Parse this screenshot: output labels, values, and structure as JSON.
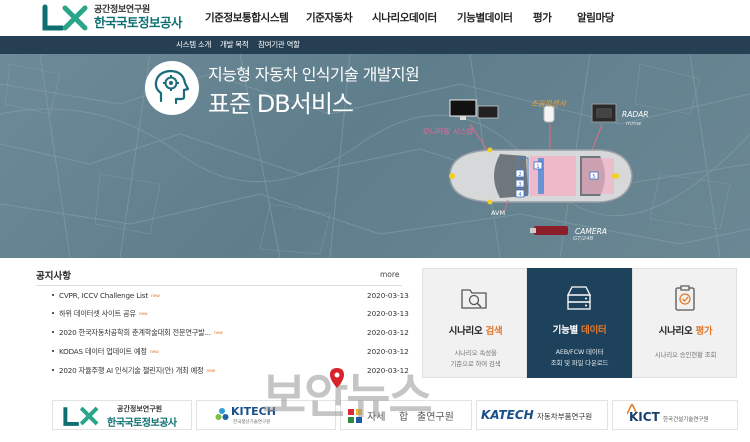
{
  "header": {
    "logo_sub": "공간정보연구원",
    "logo_main": "한국국토정보공사",
    "nav": [
      {
        "label": "기준정보통합시스템"
      },
      {
        "label": "기준자동차"
      },
      {
        "label": "시나리오데이터"
      },
      {
        "label": "기능별데이터"
      },
      {
        "label": "평가"
      },
      {
        "label": "알림마당"
      }
    ]
  },
  "subnav": {
    "items": [
      {
        "label": "시스템 소개"
      },
      {
        "label": "개발 목적"
      },
      {
        "label": "참여기관 역할"
      }
    ]
  },
  "hero": {
    "title_line1": "지능형 자동차 인식기술 개발지원",
    "title_line2": "표준 DB서비스",
    "labels": {
      "ultrasonic": "초음파센서",
      "monitoring": "모니터링 시스템",
      "radar": "RADAR",
      "radar_sub": "mmw",
      "avm": "AVM",
      "camera": "CAMERA",
      "camera_sub": "GT/24B",
      "marker1": "1",
      "marker2": "2",
      "marker3": "3",
      "marker4": "4",
      "marker5": "5"
    }
  },
  "notice": {
    "title": "공지사항",
    "more": "more",
    "new_badge": "new",
    "rows": [
      {
        "title": "CVPR, ICCV Challenge List",
        "date": "2020-03-13",
        "new": true
      },
      {
        "title": "하위 데이터셋 사이트 공유",
        "date": "2020-03-13",
        "new": true
      },
      {
        "title": "2020 한국자동차공학회 춘계학술대회 전문연구발...",
        "date": "2020-03-12",
        "new": true
      },
      {
        "title": "KODAS 데이터 업데이트 예정",
        "date": "2020-03-12",
        "new": true
      },
      {
        "title": "2020 자율주행 AI 인식기술 챌린지(안) 개최 예정",
        "date": "2020-03-12",
        "new": true
      }
    ]
  },
  "services": [
    {
      "title_a": "시나리오 ",
      "title_b": "검색",
      "desc1": "시나리오 속성을",
      "desc2": "기준으로 하여 검색"
    },
    {
      "title_a": "기능별 ",
      "title_b": "데이터",
      "desc1": "AEB/FCW 데이터",
      "desc2": "조회 및 파일 다운로드"
    },
    {
      "title_a": "시나리오 ",
      "title_b": "평가",
      "desc1": "시나리오 승인현황 조회",
      "desc2": ""
    }
  ],
  "partners": {
    "lx_sub": "공간정보연구원",
    "lx_main": "한국국토정보공사",
    "kitech": "KITECH",
    "kitech_sub": "한국생산기술연구원",
    "katri_part1": "자세",
    "katri_part2": "합",
    "katri_part3": "출연구원",
    "katech": "KATECH",
    "katech_sub": "자동차부품연구원",
    "kict": "KICT",
    "kict_sub": "한국건설기술연구원"
  },
  "watermark": "보안뉴스",
  "colors": {
    "brand_teal": "#0e6f72",
    "subnav_bg": "#263f52",
    "accent_orange": "#e07b2f",
    "dark_box": "#1e425c",
    "ultrasonic_label": "#f2a23a",
    "monitoring_label": "#e85a8c"
  }
}
